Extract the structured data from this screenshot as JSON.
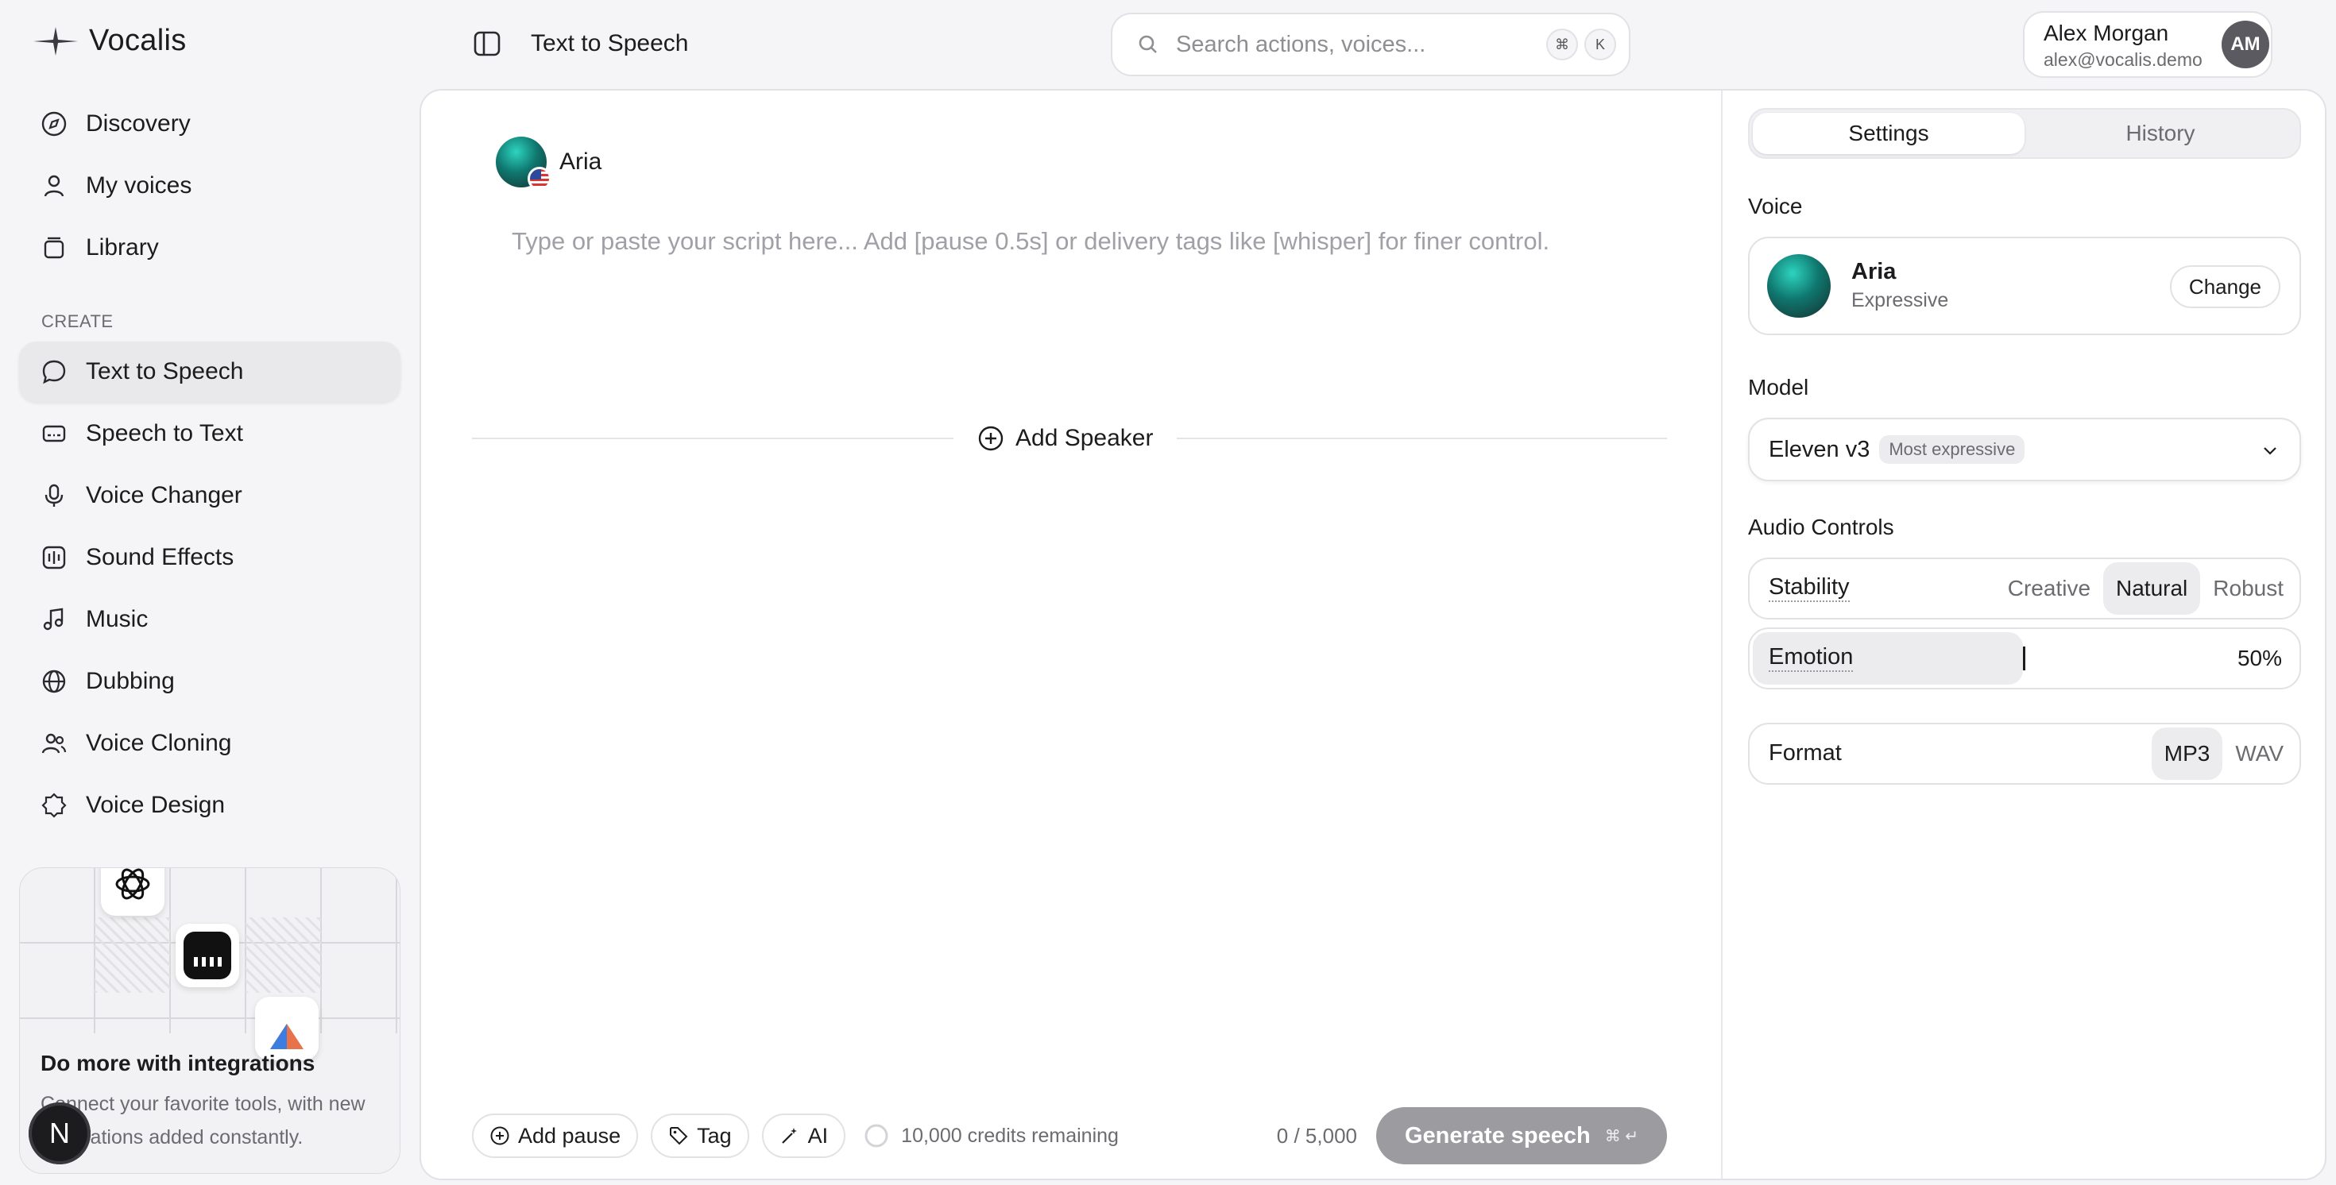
{
  "app": {
    "name": "Vocalis"
  },
  "header": {
    "page_title": "Text to Speech",
    "search_placeholder": "Search actions, voices...",
    "kbd_cmd": "⌘",
    "kbd_key": "K"
  },
  "user": {
    "name": "Alex Morgan",
    "email": "alex@vocalis.demo",
    "initials": "AM"
  },
  "sidebar": {
    "items": [
      {
        "label": "Discovery",
        "icon": "compass-icon"
      },
      {
        "label": "My voices",
        "icon": "person-icon"
      },
      {
        "label": "Library",
        "icon": "library-icon"
      }
    ],
    "section_label": "CREATE",
    "create_items": [
      {
        "label": "Text to Speech",
        "icon": "chat-bubble-icon",
        "active": true
      },
      {
        "label": "Speech to Text",
        "icon": "caption-icon"
      },
      {
        "label": "Voice Changer",
        "icon": "microphone-icon"
      },
      {
        "label": "Sound Effects",
        "icon": "waveform-icon"
      },
      {
        "label": "Music",
        "icon": "music-note-icon"
      },
      {
        "label": "Dubbing",
        "icon": "globe-icon"
      },
      {
        "label": "Voice Cloning",
        "icon": "people-icon"
      },
      {
        "label": "Voice Design",
        "icon": "design-badge-icon"
      }
    ],
    "promo": {
      "title": "Do more with integrations",
      "description": "Connect your favorite tools, with new integrations added constantly."
    },
    "badge_letter": "N"
  },
  "editor": {
    "speaker_name": "Aria",
    "script_placeholder": "Type or paste your script here... Add [pause 0.5s] or delivery tags like [whisper] for finer control.",
    "add_speaker_label": "Add Speaker",
    "add_pause_label": "Add pause",
    "tag_label": "Tag",
    "ai_label": "AI",
    "credits_text": "10,000 credits remaining",
    "char_count": "0 / 5,000",
    "generate_label": "Generate speech",
    "generate_shortcut": "⌘ ↵"
  },
  "settings": {
    "tabs": [
      {
        "label": "Settings",
        "active": true
      },
      {
        "label": "History",
        "active": false
      }
    ],
    "voice_label": "Voice",
    "voice": {
      "name": "Aria",
      "style": "Expressive",
      "change_label": "Change"
    },
    "model_label": "Model",
    "model": {
      "name": "Eleven v3",
      "chip": "Most expressive"
    },
    "audio_label": "Audio Controls",
    "stability": {
      "label": "Stability",
      "options": [
        "Creative",
        "Natural",
        "Robust"
      ],
      "selected": "Natural"
    },
    "emotion": {
      "label": "Emotion",
      "value_text": "50%",
      "value": 0.5
    },
    "format": {
      "label": "Format",
      "options": [
        "MP3",
        "WAV"
      ],
      "selected": "MP3"
    }
  },
  "colors": {
    "accent": "#1c1c1e",
    "generate_disabled": "#9b9ba0",
    "voice_orb": "#0f766e"
  }
}
